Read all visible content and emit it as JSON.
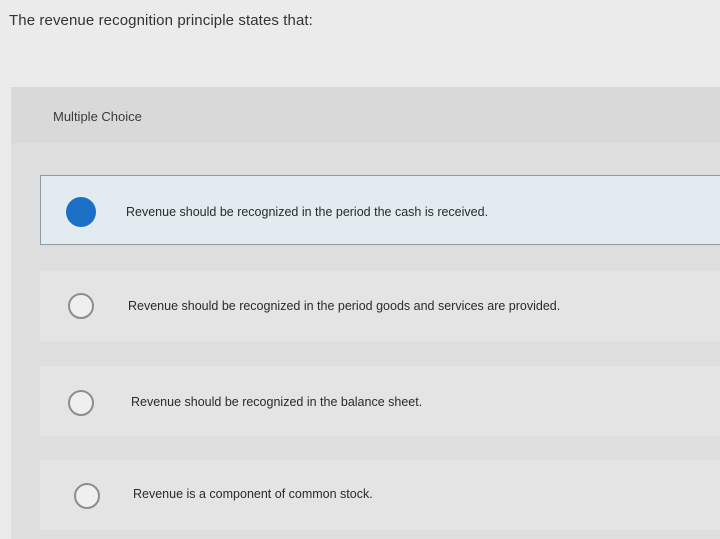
{
  "question": {
    "text": "The revenue recognition principle states that:"
  },
  "panel": {
    "type_label": "Multiple Choice"
  },
  "choices": [
    {
      "text": "Revenue should be recognized in the period the cash is received.",
      "selected": true
    },
    {
      "text": "Revenue should be recognized in the period goods and services are provided.",
      "selected": false
    },
    {
      "text": "Revenue should be recognized in the balance sheet.",
      "selected": false
    },
    {
      "text": "Revenue is a component of common stock.",
      "selected": false
    }
  ],
  "colors": {
    "selected_radio": "#1b6fc5",
    "selected_background": "#e2ebf0"
  }
}
